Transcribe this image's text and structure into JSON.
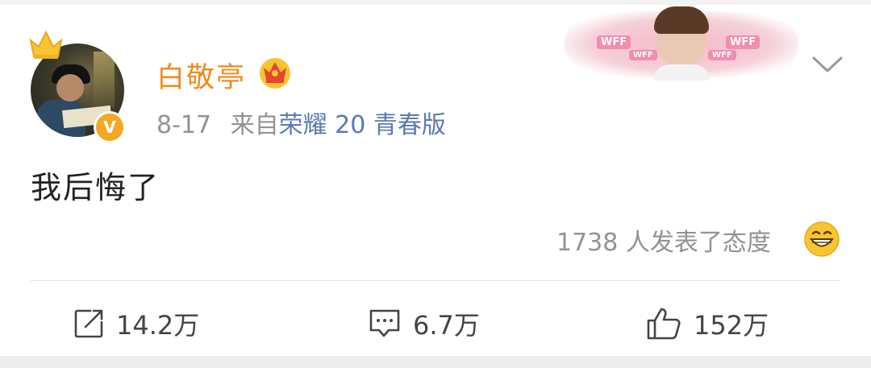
{
  "post": {
    "username": "白敬亭",
    "date": "8-17",
    "source_prefix": "来自",
    "source_device": "荣耀 20 青春版",
    "content": "我后悔了",
    "reactions_text": "1738 人发表了态度"
  },
  "decoration": {
    "tag_text": "WFF"
  },
  "actions": {
    "repost_count": "14.2万",
    "comment_count": "6.7万",
    "like_count": "152万"
  },
  "icons": {
    "verified": "verified-v-badge",
    "crown": "crown-icon",
    "repost": "repost-icon",
    "comment": "comment-icon",
    "like": "thumbs-up-icon",
    "menu": "chevron-down-icon",
    "emoji": "grin-emoji-icon"
  },
  "colors": {
    "username": "#f18a1b",
    "source_link": "#5a7ab0",
    "meta_text": "#939393",
    "badge": "#f5a623"
  }
}
